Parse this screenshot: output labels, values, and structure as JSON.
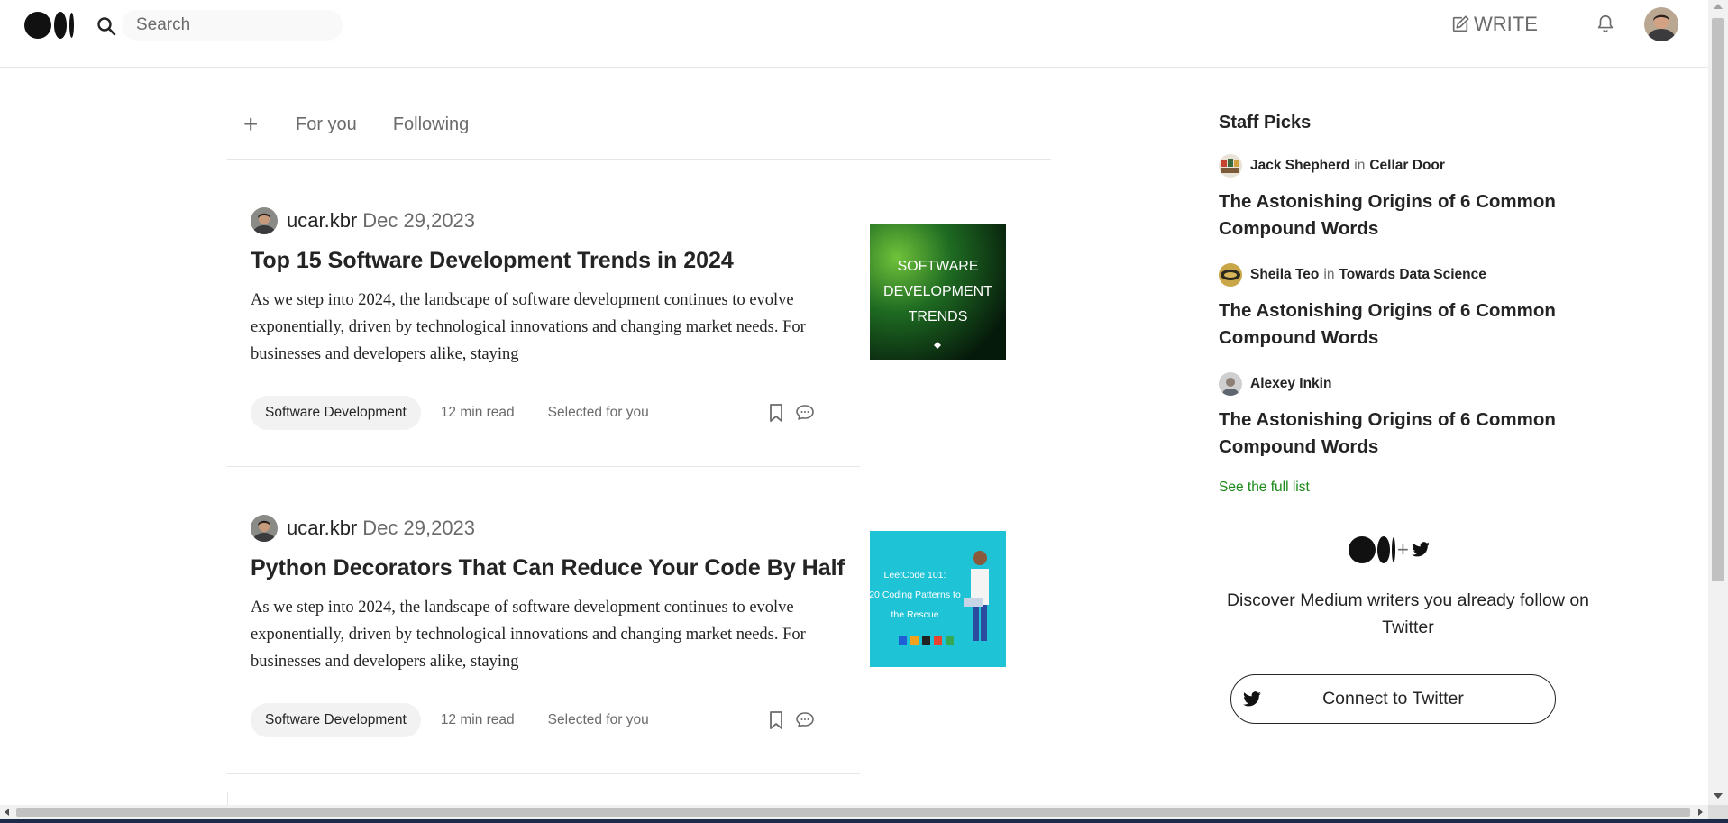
{
  "header": {
    "search_placeholder": "Search",
    "write_label": "WRITE",
    "icons": [
      "medium-logo-icon",
      "search-icon",
      "write-icon",
      "bell-icon",
      "avatar"
    ]
  },
  "tabs": {
    "plus": "+",
    "items": [
      {
        "label": "For you"
      },
      {
        "label": "Following"
      }
    ]
  },
  "articles": [
    {
      "author": "ucar.kbr",
      "date": "Dec 29,2023",
      "title": "Top 15 Software Development Trends in 2024",
      "excerpt": "As we step into 2024, the landscape of software development continues to evolve exponentially, driven by technological innovations and changing market needs. For businesses and developers alike, staying",
      "tag": "Software Development",
      "read_time": "12 min read",
      "reason": "Selected for you",
      "thumbnail_text": [
        "SOFTWARE",
        "DEVELOPMENT",
        "TRENDS"
      ]
    },
    {
      "author": "ucar.kbr",
      "date": "Dec 29,2023",
      "title": "Python Decorators That Can Reduce Your Code By Half",
      "excerpt": "As we step into 2024, the landscape of software development continues to evolve exponentially, driven by technological innovations and changing market needs. For businesses and developers alike, staying",
      "tag": "Software Development",
      "read_time": "12 min read",
      "reason": "Selected for you",
      "thumbnail_text": [
        "LeetCode 101:",
        "20 Coding Patterns to",
        "the Rescue"
      ]
    }
  ],
  "sidebar": {
    "heading": "Staff Picks",
    "picks": [
      {
        "writer": "Jack Shepherd",
        "in": "in",
        "publication": "Cellar Door",
        "title": "The Astonishing Origins of 6 Common Compound Words"
      },
      {
        "writer": "Sheila Teo",
        "in": "in",
        "publication": "Towards Data Science",
        "title": "The Astonishing Origins of 6 Common Compound Words"
      },
      {
        "writer": "Alexey Inkin",
        "in": "",
        "publication": "",
        "title": "The Astonishing Origins of 6 Common Compound Words"
      }
    ],
    "see_full_list": "See the full list",
    "twitter_plus": "+",
    "discover_text": "Discover Medium writers you already follow on Twitter",
    "connect_label": "Connect to Twitter"
  },
  "colors": {
    "text": "#242424",
    "muted": "#6b6b6b",
    "accent_green": "#1a8917",
    "divider": "#e6e6e6",
    "tag_bg": "#f2f2f2",
    "thumb1_bg": "#1f6b1f",
    "thumb2_bg": "#1fc3d6"
  }
}
